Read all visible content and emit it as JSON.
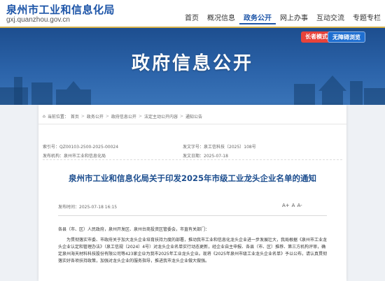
{
  "header": {
    "site_title": "泉州市工业和信息化局",
    "site_url": "gxj.quanzhou.gov.cn",
    "nav": [
      {
        "label": "首页"
      },
      {
        "label": "概况信息"
      },
      {
        "label": "政务公开"
      },
      {
        "label": "网上办事"
      },
      {
        "label": "互动交流"
      },
      {
        "label": "专题专栏"
      }
    ],
    "active_nav": "政务公开"
  },
  "banner": {
    "title": "政府信息公开",
    "elder_mode": "长者模式",
    "barrier_free": "无障碍浏览"
  },
  "breadcrumb": {
    "prefix": "当前位置：",
    "items": [
      "首页",
      "政务公开",
      "政府信息公开",
      "法定主动公开内容",
      "通知公告"
    ]
  },
  "meta": {
    "index_label": "索引号：",
    "index_value": "QZ00103-2500-2025-00024",
    "docno_label": "发文字号：",
    "docno_value": "泉工信科技〔2025〕108号",
    "publisher_label": "发布机构：",
    "publisher_value": "泉州市工业和信息化局",
    "date_label": "发文日期：",
    "date_value": "2025-07-18"
  },
  "document": {
    "title": "泉州市工业和信息化局关于印发2025年市级工业龙头企业名单的通知",
    "publish_time_label": "发布时间：",
    "publish_time": "2025-07-18 16:15",
    "font_large": "A+",
    "font_medium": "A",
    "font_small": "A-",
    "recipients": "各县（市、区）人民政府，泉州开发区、泉州台商投资区管委会，市直有关部门：",
    "paragraph": "为贯彻落实市委、市政府关于加大龙头企业培育扶持力度的部署，推动我市工业和信息化龙头企业进一步发展壮大，我局根据《泉州市工业龙头企业认定和管理办法》（泉工信规〔2024〕4号）对龙头企业名单实行动态更新，经企业自主申报、各县（市、区）推荐、第三方机构评审，确定泉州海天材料科技股份有限公司等423家企业为我市2025年工业龙头企业。现将《2025年泉州市级工业龙头企业名单》予以公布，请认真贯彻落实好各项扶持政策，加强对龙头企业的服务指导，推进我市龙头企业做大做强。"
  }
}
